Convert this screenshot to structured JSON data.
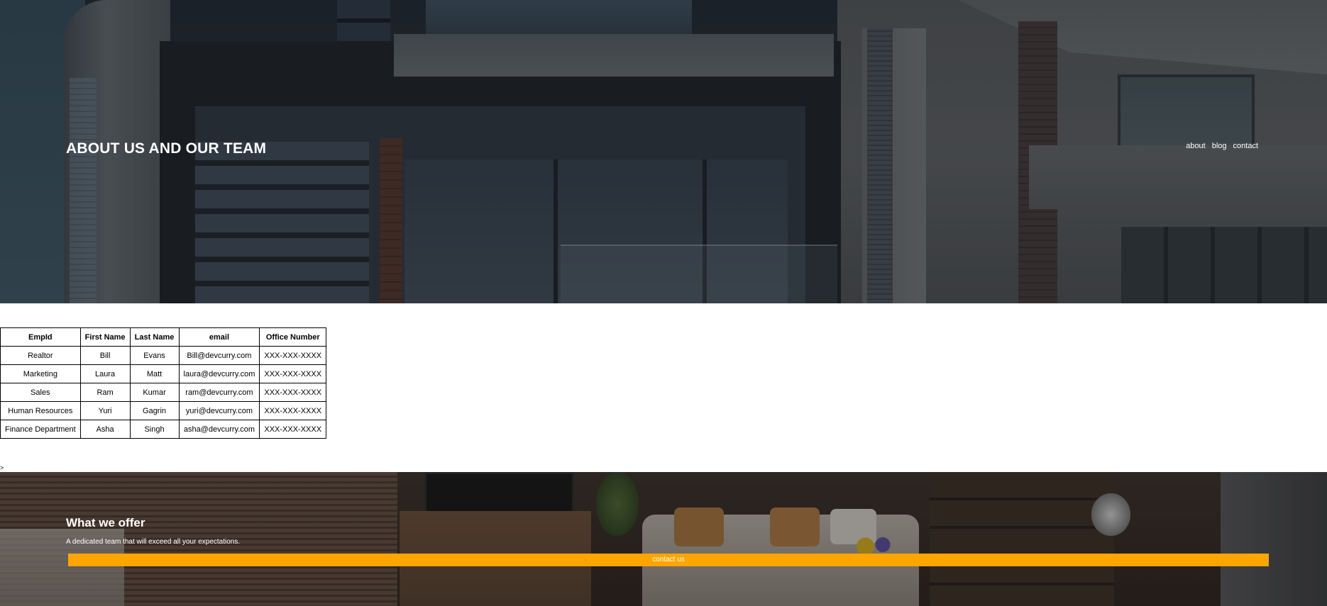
{
  "hero": {
    "title": "ABOUT US AND OUR TEAM",
    "nav": [
      "about",
      "blog",
      "contact"
    ]
  },
  "team_table": {
    "headers": [
      "EmpId",
      "First Name",
      "Last Name",
      "email",
      "Office Number"
    ],
    "rows": [
      [
        "Realtor",
        "Bill",
        "Evans",
        "Bill@devcurry.com",
        "XXX-XXX-XXXX"
      ],
      [
        "Marketing",
        "Laura",
        "Matt",
        "laura@devcurry.com",
        "XXX-XXX-XXXX"
      ],
      [
        "Sales",
        "Ram",
        "Kumar",
        "ram@devcurry.com",
        "XXX-XXX-XXXX"
      ],
      [
        "Human Resources",
        "Yuri",
        "Gagrin",
        "yuri@devcurry.com",
        "XXX-XXX-XXXX"
      ],
      [
        "Finance Department",
        "Asha",
        "Singh",
        "asha@devcurry.com",
        "XXX-XXX-XXXX"
      ]
    ]
  },
  "stray_text": ">",
  "offer": {
    "title": "What we offer",
    "subtitle": "A dedicated team that will exceed all your expectations.",
    "button_label": "contact us",
    "button_color": "#ffa500"
  }
}
